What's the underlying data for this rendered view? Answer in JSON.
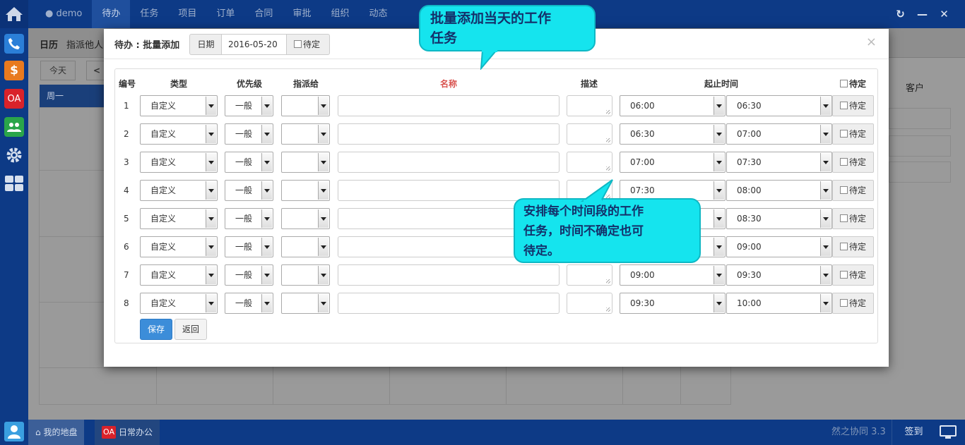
{
  "topbar": {
    "user": "demo",
    "nav": [
      "待办",
      "任务",
      "项目",
      "订单",
      "合同",
      "审批",
      "组织",
      "动态"
    ],
    "active_nav": "待办"
  },
  "leftbar": {
    "apps": [
      "phone-icon",
      "dollar-icon",
      "OA",
      "team-icon",
      "gear-icon",
      "grid-icon"
    ]
  },
  "background": {
    "title": "日历",
    "subtitle": "指派他人",
    "today_button": "今天",
    "week_label": "周一",
    "customer_label": "客户"
  },
  "modal": {
    "title": "待办 : 批量添加",
    "date_label": "日期",
    "date_value": "2016-05-20",
    "pending_label": "待定",
    "close": "×",
    "headers": {
      "num": "编号",
      "type": "类型",
      "priority": "优先级",
      "assign": "指派给",
      "name": "名称",
      "desc": "描述",
      "time": "起止时间",
      "pending": "待定"
    },
    "rows": [
      {
        "num": "1",
        "type": "自定义",
        "priority": "一般",
        "start": "06:00",
        "end": "06:30",
        "pending": "待定"
      },
      {
        "num": "2",
        "type": "自定义",
        "priority": "一般",
        "start": "06:30",
        "end": "07:00",
        "pending": "待定"
      },
      {
        "num": "3",
        "type": "自定义",
        "priority": "一般",
        "start": "07:00",
        "end": "07:30",
        "pending": "待定"
      },
      {
        "num": "4",
        "type": "自定义",
        "priority": "一般",
        "start": "07:30",
        "end": "08:00",
        "pending": "待定"
      },
      {
        "num": "5",
        "type": "自定义",
        "priority": "一般",
        "start": "",
        "end": "08:30",
        "pending": "待定"
      },
      {
        "num": "6",
        "type": "自定义",
        "priority": "一般",
        "start": "",
        "end": "09:00",
        "pending": "待定"
      },
      {
        "num": "7",
        "type": "自定义",
        "priority": "一般",
        "start": "09:00",
        "end": "09:30",
        "pending": "待定"
      },
      {
        "num": "8",
        "type": "自定义",
        "priority": "一般",
        "start": "09:30",
        "end": "10:00",
        "pending": "待定"
      }
    ],
    "save_button": "保存",
    "back_button": "返回"
  },
  "callouts": {
    "top_line1": "批量添加当天的工作",
    "top_line2": "任务",
    "mid_line1": "安排每个时间段的工作",
    "mid_line2": "任务，时间不确定也可",
    "mid_line3": "待定。"
  },
  "bottombar": {
    "task_home": "我的地盘",
    "task_oa_badge": "OA",
    "task_oa": "日常办公",
    "version": "然之协同 3.3",
    "signin": "签到"
  },
  "colors": {
    "nav_bg": "#0d3a86",
    "primary_button": "#3c8dd9",
    "name_header": "#d9534f",
    "callout": "#15e4ee"
  }
}
